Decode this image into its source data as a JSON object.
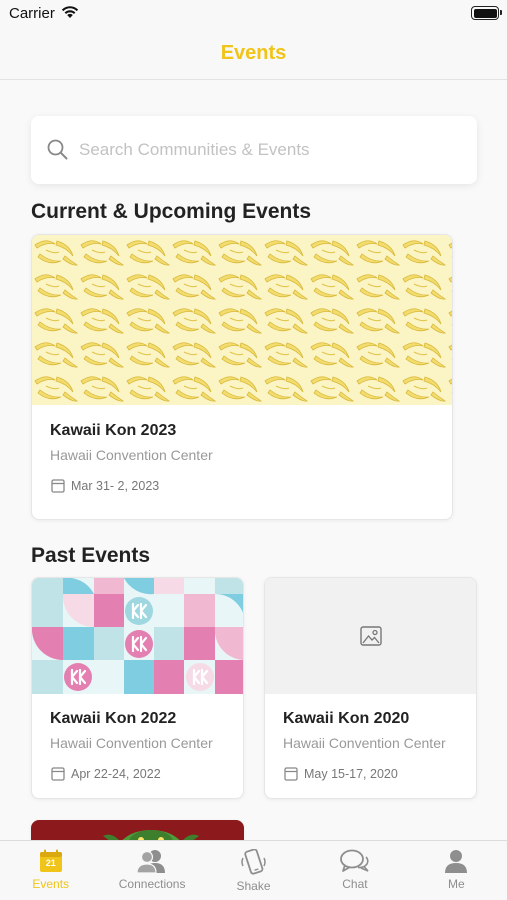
{
  "status_bar": {
    "carrier": "Carrier"
  },
  "nav": {
    "title": "Events"
  },
  "search": {
    "placeholder": "Search Communities & Events"
  },
  "sections": {
    "current_title": "Current & Upcoming Events",
    "past_title": "Past Events"
  },
  "current_events": [
    {
      "title": "Kawaii Kon 2023",
      "venue": "Hawaii Convention Center",
      "date": "Mar 31- 2, 2023",
      "image": "banana-pattern"
    }
  ],
  "past_events": [
    {
      "title": "Kawaii Kon 2022",
      "venue": "Hawaii Convention Center",
      "date": "Apr 22-24, 2022",
      "image": "kk-geometric-pattern"
    },
    {
      "title": "Kawaii Kon 2020",
      "venue": "Hawaii Convention Center",
      "date": "May 15-17, 2020",
      "image": "image-placeholder-icon"
    }
  ],
  "tabbar": {
    "calendar_day": "21",
    "items": [
      {
        "label": "Events",
        "icon": "calendar-icon",
        "active": true
      },
      {
        "label": "Connections",
        "icon": "people-icon",
        "active": false
      },
      {
        "label": "Shake",
        "icon": "phone-shake-icon",
        "active": false
      },
      {
        "label": "Chat",
        "icon": "chat-bubbles-icon",
        "active": false
      },
      {
        "label": "Me",
        "icon": "person-icon",
        "active": false
      }
    ]
  },
  "colors": {
    "accent": "#f0c419",
    "background": "#f9f9f9",
    "muted_text": "#999999"
  }
}
